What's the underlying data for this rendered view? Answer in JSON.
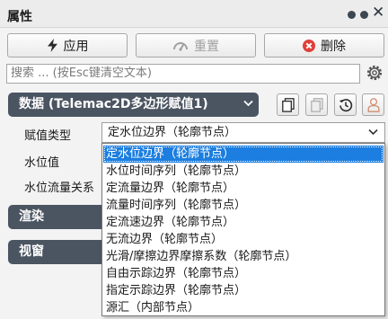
{
  "panel": {
    "title": "属性"
  },
  "toolbar": {
    "apply_label": "应用",
    "reset_label": "重置",
    "delete_label": "删除"
  },
  "search": {
    "placeholder": "搜索 ... (按Esc键清空文本)"
  },
  "groups": {
    "data_title": "数据 (Telemac2D多边形赋值1)",
    "render_title": "渲染",
    "viewport_title": "视窗"
  },
  "fields": {
    "assign_type_label": "赋值类型",
    "water_level_label": "水位值",
    "stage_discharge_label": "水位流量关系"
  },
  "assign_type": {
    "selected": "定水位边界（轮廓节点）",
    "options": [
      "定水位边界（轮廓节点）",
      "水位时间序列（轮廓节点）",
      "定流量边界（轮廓节点）",
      "流量时间序列（轮廓节点）",
      "定流速边界（轮廓节点）",
      "无流边界（轮廓节点）",
      "光滑/摩擦边界摩擦系数（轮廓节点）",
      "自由示踪边界（轮廓节点）",
      "指定示踪边界（轮廓节点）",
      "源汇（内部节点）"
    ]
  },
  "colors": {
    "accent_selection": "#1b7ee0",
    "group_header": "#4b5562",
    "delete_icon": "#e0403a"
  }
}
